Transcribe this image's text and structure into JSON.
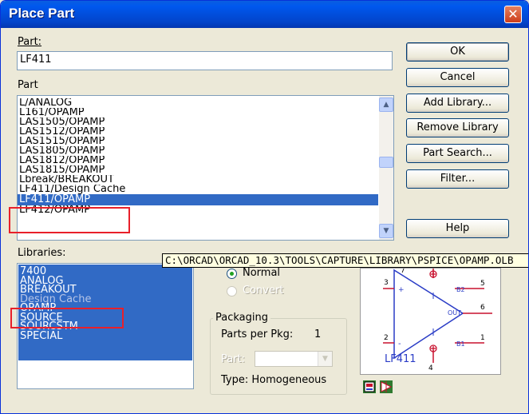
{
  "window": {
    "title": "Place Part",
    "close": "✕"
  },
  "part_field": {
    "label": "Part:",
    "value": "LF411"
  },
  "part_list": {
    "label": "Part",
    "items": [
      "L/ANALOG",
      "L161/OPAMP",
      "LAS1505/OPAMP",
      "LAS1512/OPAMP",
      "LAS1515/OPAMP",
      "LAS1805/OPAMP",
      "LAS1812/OPAMP",
      "LAS1815/OPAMP",
      "Lbreak/BREAKOUT",
      "LF411/Design Cache",
      "LF411/OPAMP",
      "LF412/OPAMP"
    ],
    "selected_index": 10
  },
  "libraries": {
    "label": "Libraries:",
    "items": [
      "7400",
      "ANALOG",
      "BREAKOUT",
      "Design Cache",
      "OPAMP",
      "SOURCE",
      "SOURCSTM",
      "SPECIAL"
    ]
  },
  "buttons": {
    "ok": "OK",
    "cancel": "Cancel",
    "add_library": "Add Library...",
    "remove_library": "Remove Library",
    "part_search": "Part Search...",
    "filter": "Filter...",
    "help": "Help"
  },
  "tooltip": "C:\\ORCAD\\ORCAD_10.3\\TOOLS\\CAPTURE\\LIBRARY\\PSPICE\\OPAMP.OLB",
  "graphic": {
    "normal": "Normal",
    "convert": "Convert"
  },
  "packaging": {
    "title": "Packaging",
    "parts_per_pkg_label": "Parts per Pkg:",
    "parts_per_pkg_value": "1",
    "part_label": "Part:",
    "type_label": "Type: Homogeneous"
  },
  "symbol": {
    "name": "LF411",
    "pins": [
      "3",
      "2",
      "4",
      "5",
      "6",
      "1",
      "7"
    ],
    "pin_labels": [
      "+",
      "-",
      "B2",
      "OUT",
      "B1"
    ]
  },
  "colors": {
    "accent": "#316ac5",
    "title_bar": "#0058ee",
    "highlight_box": "#e8202a",
    "schematic_blue": "#2a3cc6",
    "schematic_red": "#c8102e"
  }
}
